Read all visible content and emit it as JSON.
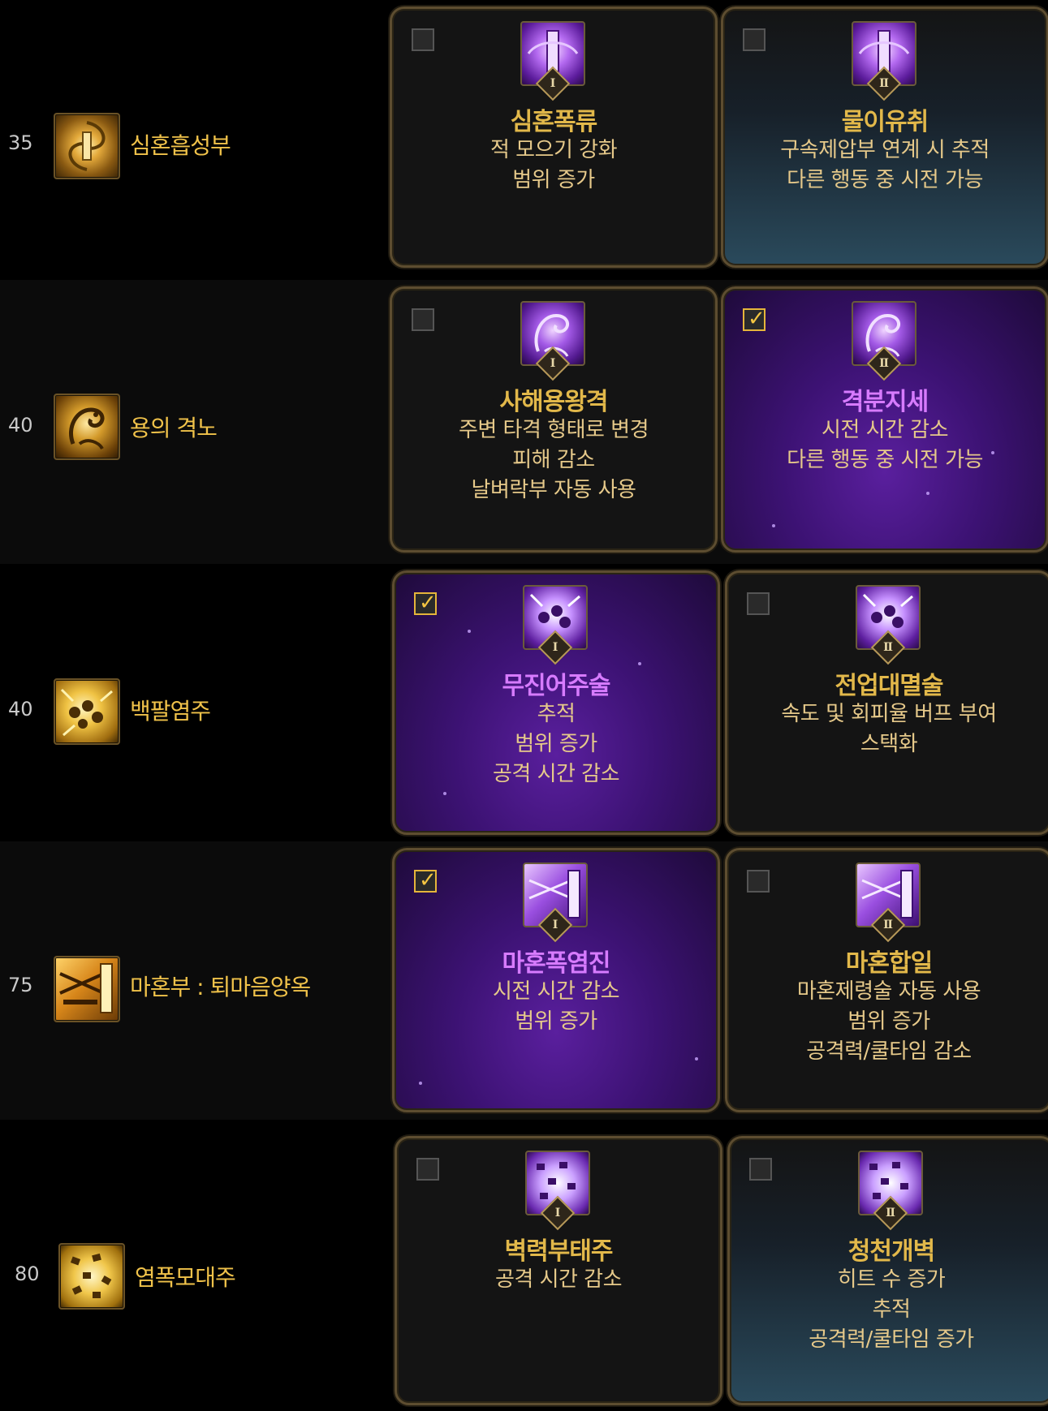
{
  "rows": [
    {
      "level": "35",
      "skill_name": "심혼흡성부",
      "options": [
        {
          "roman": "I",
          "title": "심혼폭류",
          "desc": [
            "적 모으기 강화",
            "범위 증가"
          ],
          "checked": false
        },
        {
          "roman": "II",
          "title": "물이유취",
          "desc": [
            "구속제압부 연계 시 추적",
            "다른 행동 중 시전 가능"
          ],
          "checked": false
        }
      ]
    },
    {
      "level": "40",
      "skill_name": "용의 격노",
      "options": [
        {
          "roman": "I",
          "title": "사해용왕격",
          "desc": [
            "주변 타격 형태로 변경",
            "피해 감소",
            "날벼락부 자동 사용"
          ],
          "checked": false
        },
        {
          "roman": "II",
          "title": "격분지세",
          "desc": [
            "시전 시간 감소",
            "다른 행동 중 시전 가능"
          ],
          "checked": true
        }
      ]
    },
    {
      "level": "40",
      "skill_name": "백팔염주",
      "options": [
        {
          "roman": "I",
          "title": "무진어주술",
          "desc": [
            "추적",
            "범위 증가",
            "공격 시간 감소"
          ],
          "checked": true
        },
        {
          "roman": "II",
          "title": "전업대멸술",
          "desc": [
            "속도 및 회피율 버프 부여",
            "스택화"
          ],
          "checked": false
        }
      ]
    },
    {
      "level": "75",
      "skill_name": "마혼부 : 퇴마음양옥",
      "options": [
        {
          "roman": "I",
          "title": "마혼폭염진",
          "desc": [
            "시전 시간 감소",
            "범위 증가"
          ],
          "checked": true
        },
        {
          "roman": "II",
          "title": "마혼합일",
          "desc": [
            "마혼제령술 자동 사용",
            "범위 증가",
            "공격력/쿨타임 감소"
          ],
          "checked": false
        }
      ]
    },
    {
      "level": "80",
      "skill_name": "염폭모대주",
      "options": [
        {
          "roman": "I",
          "title": "벽력부태주",
          "desc": [
            "공격 시간 감소"
          ],
          "checked": false
        },
        {
          "roman": "II",
          "title": "청천개벽",
          "desc": [
            "히트 수 증가",
            "추적",
            "공격력/쿨타임 증가"
          ],
          "checked": false
        }
      ]
    }
  ],
  "colors": {
    "title_gold": "#e2b84a",
    "title_purple": "#d77bff",
    "desc_text": "#e6c98a",
    "skill_name": "#f0c24a",
    "border": "#5d4d30"
  }
}
